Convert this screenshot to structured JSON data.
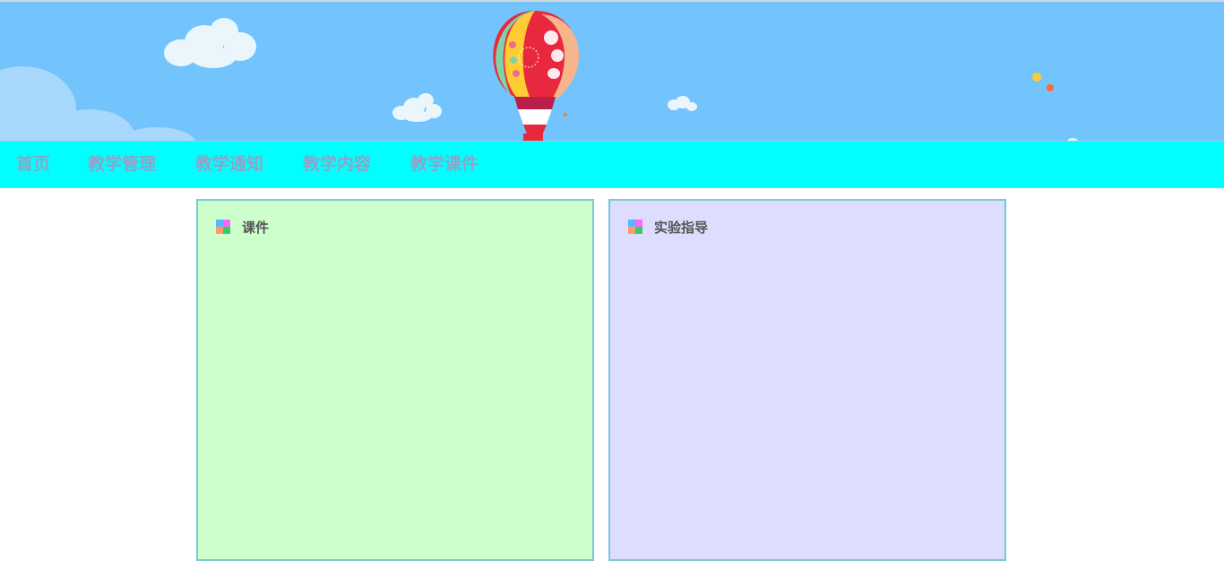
{
  "nav": {
    "items": [
      {
        "label": "首页"
      },
      {
        "label": "教学管理"
      },
      {
        "label": "教学通知"
      },
      {
        "label": "教学内容"
      },
      {
        "label": "教学课件"
      }
    ]
  },
  "panels": [
    {
      "title": "课件",
      "background": "#ccffcc"
    },
    {
      "title": "实验指导",
      "background": "#ddddff"
    }
  ],
  "colors": {
    "banner_sky": "#73c4fd",
    "nav_background": "#00ffff",
    "nav_text": "#8fa3c9",
    "panel_border": "#77c9d4",
    "icon_quadrants": [
      "#5ab4ff",
      "#ff66ff",
      "#ff9966",
      "#33cc66"
    ]
  },
  "icons": {
    "banner_decoration": "hot-air-balloon",
    "panel_icon": "four-color-grid-icon"
  }
}
